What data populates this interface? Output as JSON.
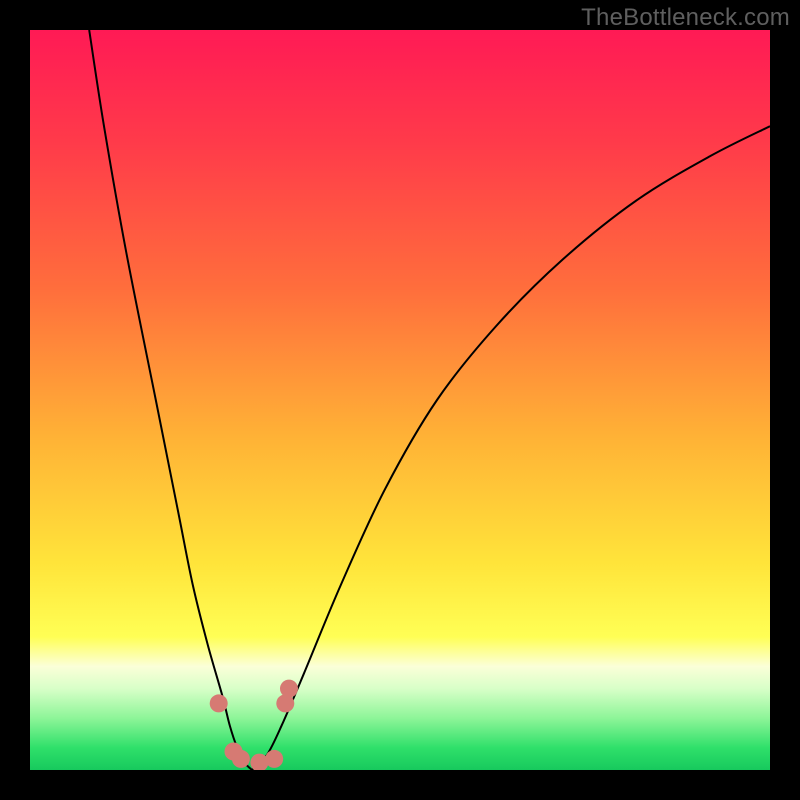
{
  "watermark": "TheBottleneck.com",
  "chart_data": {
    "type": "line",
    "title": "",
    "xlabel": "",
    "ylabel": "",
    "xlim": [
      0,
      100
    ],
    "ylim": [
      0,
      100
    ],
    "series": [
      {
        "name": "left-branch",
        "x": [
          8,
          10,
          13,
          17,
          20,
          22,
          24,
          26,
          27,
          28,
          29,
          30
        ],
        "values": [
          100,
          87,
          70,
          50,
          35,
          25,
          17,
          10,
          6,
          3,
          1,
          0
        ]
      },
      {
        "name": "right-branch",
        "x": [
          30,
          32,
          34,
          37,
          42,
          48,
          55,
          63,
          72,
          82,
          92,
          100
        ],
        "values": [
          0,
          2,
          6,
          13,
          25,
          38,
          50,
          60,
          69,
          77,
          83,
          87
        ]
      }
    ],
    "markers": [
      {
        "x": 25.5,
        "y": 9
      },
      {
        "x": 27.5,
        "y": 2.5
      },
      {
        "x": 28.5,
        "y": 1.5
      },
      {
        "x": 31.0,
        "y": 1.0
      },
      {
        "x": 33.0,
        "y": 1.5
      },
      {
        "x": 34.5,
        "y": 9
      },
      {
        "x": 35.0,
        "y": 11
      }
    ],
    "gradient_stops": [
      {
        "offset": 0.0,
        "color": "#ff1a55"
      },
      {
        "offset": 0.15,
        "color": "#ff3a4a"
      },
      {
        "offset": 0.35,
        "color": "#ff6e3c"
      },
      {
        "offset": 0.55,
        "color": "#ffb236"
      },
      {
        "offset": 0.72,
        "color": "#ffe43a"
      },
      {
        "offset": 0.82,
        "color": "#ffff55"
      },
      {
        "offset": 0.86,
        "color": "#fbffd8"
      },
      {
        "offset": 0.89,
        "color": "#d8ffc8"
      },
      {
        "offset": 0.93,
        "color": "#8df598"
      },
      {
        "offset": 0.97,
        "color": "#2fe06a"
      },
      {
        "offset": 1.0,
        "color": "#17c95d"
      }
    ],
    "marker_color": "#d67a73",
    "curve_color": "#000000"
  }
}
